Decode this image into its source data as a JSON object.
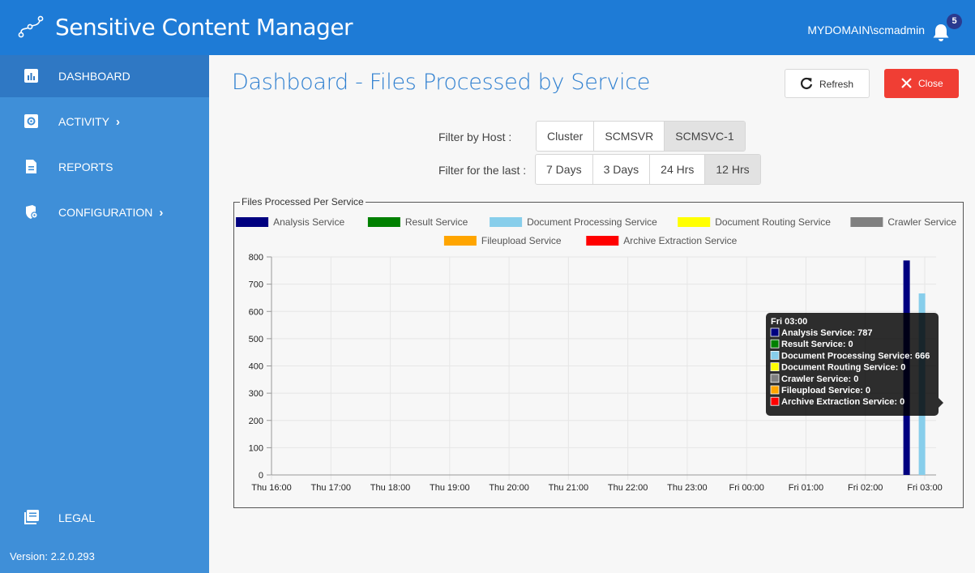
{
  "app": {
    "title": "Sensitive Content Manager",
    "user": "MYDOMAIN\\scmadmin",
    "notifications": "5"
  },
  "sidebar": {
    "items": [
      {
        "label": "DASHBOARD",
        "icon": "bar-chart-icon",
        "active": true
      },
      {
        "label": "ACTIVITY",
        "icon": "gear-icon",
        "has_chevron": true
      },
      {
        "label": "REPORTS",
        "icon": "document-icon"
      },
      {
        "label": "CONFIGURATION",
        "icon": "cog-shield-icon",
        "has_chevron": true
      }
    ],
    "legal": {
      "label": "LEGAL",
      "icon": "book-icon"
    },
    "version": "Version: 2.2.0.293"
  },
  "header": {
    "title": "Dashboard - Files Processed by Service",
    "refresh_label": "Refresh",
    "close_label": "Close"
  },
  "filters": {
    "host_label": "Filter by Host :",
    "host_options": [
      "Cluster",
      "SCMSVR",
      "SCMSVC-1"
    ],
    "host_selected": "SCMSVC-1",
    "time_label": "Filter for the last :",
    "time_options": [
      "7 Days",
      "3 Days",
      "24 Hrs",
      "12 Hrs"
    ],
    "time_selected": "12 Hrs"
  },
  "colors": {
    "topbar": "#1e7bd6",
    "sidebar": "#3f8fd8",
    "accent": "#2e7fd0",
    "close": "#f03e34"
  },
  "chart_data": {
    "type": "bar",
    "title": "Files Processed Per Service",
    "x": [
      "Thu 16:00",
      "Thu 17:00",
      "Thu 18:00",
      "Thu 19:00",
      "Thu 20:00",
      "Thu 21:00",
      "Thu 22:00",
      "Thu 23:00",
      "Fri 00:00",
      "Fri 01:00",
      "Fri 02:00",
      "Fri 03:00"
    ],
    "ylim": [
      0,
      800
    ],
    "yticks": [
      0,
      100,
      200,
      300,
      400,
      500,
      600,
      700,
      800
    ],
    "grid": true,
    "legend_position": "top",
    "series": [
      {
        "name": "Analysis Service",
        "color": "#000080",
        "values": [
          0,
          0,
          0,
          0,
          0,
          0,
          0,
          0,
          0,
          0,
          0,
          787
        ]
      },
      {
        "name": "Result Service",
        "color": "#008000",
        "values": [
          0,
          0,
          0,
          0,
          0,
          0,
          0,
          0,
          0,
          0,
          0,
          0
        ]
      },
      {
        "name": "Document Processing Service",
        "color": "#87ceeb",
        "values": [
          0,
          0,
          0,
          0,
          0,
          0,
          0,
          0,
          0,
          0,
          0,
          666
        ]
      },
      {
        "name": "Document Routing Service",
        "color": "#ffff00",
        "values": [
          0,
          0,
          0,
          0,
          0,
          0,
          0,
          0,
          0,
          0,
          0,
          0
        ]
      },
      {
        "name": "Crawler Service",
        "color": "#808080",
        "values": [
          0,
          0,
          0,
          0,
          0,
          0,
          0,
          0,
          0,
          0,
          0,
          0
        ]
      },
      {
        "name": "Fileupload Service",
        "color": "#ffa500",
        "values": [
          0,
          0,
          0,
          0,
          0,
          0,
          0,
          0,
          0,
          0,
          0,
          0
        ]
      },
      {
        "name": "Archive Extraction Service",
        "color": "#ff0000",
        "values": [
          0,
          0,
          0,
          0,
          0,
          0,
          0,
          0,
          0,
          0,
          0,
          0
        ]
      }
    ],
    "tooltip": {
      "title": "Fri 03:00",
      "lines": [
        "Analysis Service: 787",
        "Result Service: 0",
        "Document Processing Service: 666",
        "Document Routing Service: 0",
        "Crawler Service: 0",
        "Fileupload Service: 0",
        "Archive Extraction Service: 0"
      ]
    }
  }
}
